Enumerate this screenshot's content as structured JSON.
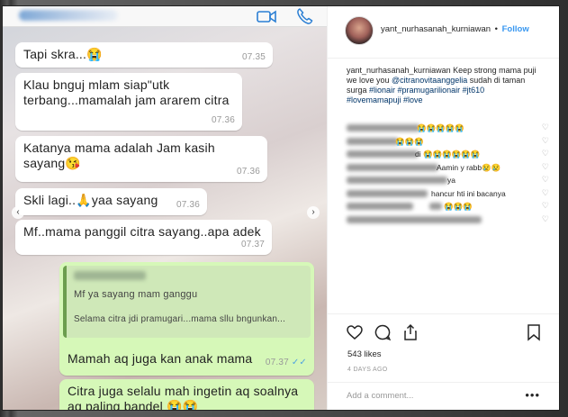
{
  "chat": {
    "messages": [
      {
        "text": "Tapi skra...😭",
        "time": "07.35"
      },
      {
        "text": "Klau bnguj mlam siap\"utk terbang...mamalah jam ararem citra",
        "time": "07.36"
      },
      {
        "text": "Katanya mama adalah Jam kasih sayang😘",
        "time": "07.36"
      },
      {
        "text": "Skli lagi..🙏yaa sayang",
        "time": "07.36"
      },
      {
        "text": "Mf..mama panggil citra sayang..apa adek",
        "time": "07.37"
      }
    ],
    "reply": {
      "quote_line1": "Mf ya sayang mam ganggu",
      "quote_line2": "Selama citra jdi pramugari...mama sllu bngunkan...",
      "text": "Mamah aq juga kan anak mama",
      "time": "07.37",
      "ticks": "✓✓"
    },
    "last_message": "Citra juga selalu mah ingetin aq soalnya aq paling bandel 😭😭"
  },
  "instagram": {
    "username": "yant_nurhasanah_kurniawan",
    "separator": "•",
    "follow_label": "Follow",
    "caption": {
      "user": "yant_nurhasanah_kurniawan",
      "text": "Keep strong mama puji we love you",
      "mention": "@citranovitaanggelia",
      "text2": "sudah di taman surga",
      "tags": "#lionair #pramugarilionair #jt610 #lovemamapuji #love"
    },
    "comments": [
      {
        "text": "😭😭😭😭😭"
      },
      {
        "text": "😭😭😭"
      },
      {
        "text": "di 😭😭😭😭😭😭"
      },
      {
        "text": "Aamin y rabb😢😢"
      },
      {
        "text": "ya"
      },
      {
        "text": "hancur hti ini bacanya"
      },
      {
        "text": "😭😭😭"
      },
      {
        "text": ""
      }
    ],
    "likes": "543 likes",
    "time_ago": "4 DAYS AGO",
    "add_comment_placeholder": "Add a comment...",
    "more_label": "•••"
  }
}
